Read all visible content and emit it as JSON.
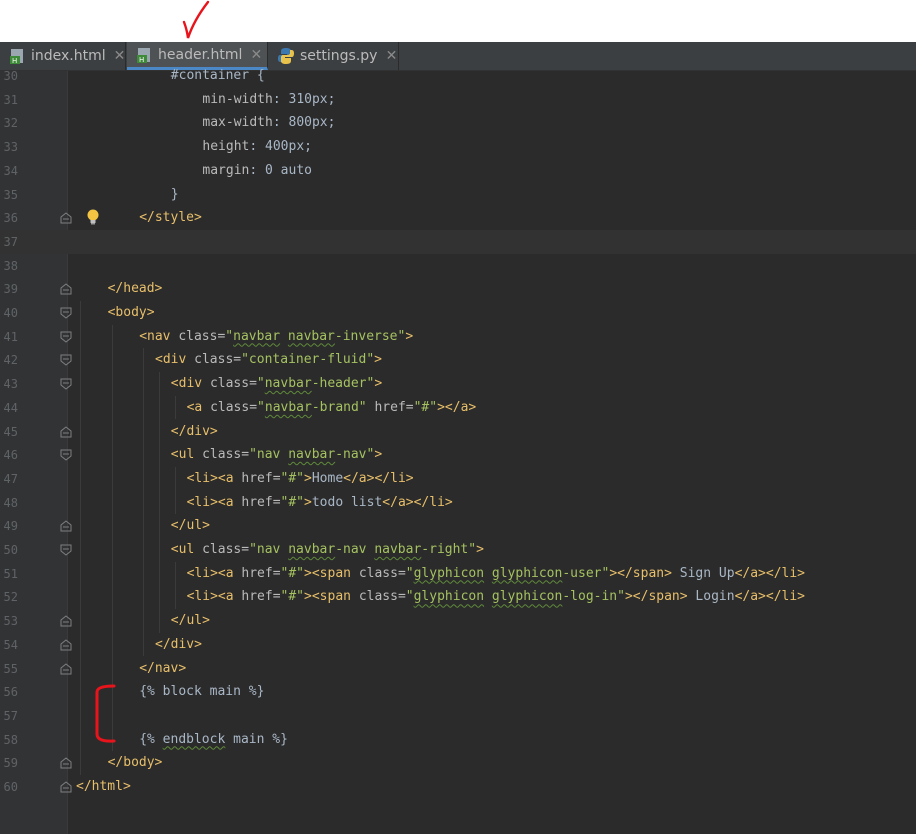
{
  "tabs": [
    {
      "name": "index.html",
      "active": false,
      "type": "html"
    },
    {
      "name": "header.html",
      "active": true,
      "type": "html"
    },
    {
      "name": "settings.py",
      "active": false,
      "type": "python"
    }
  ],
  "current_line": 37,
  "lines": [
    {
      "n": "30",
      "code": [
        {
          "t": "#container {",
          "c": "txt"
        }
      ]
    },
    {
      "n": "31",
      "code": [
        {
          "t": "min-width",
          "c": "prop"
        },
        {
          "t": ": ",
          "c": "txt"
        },
        {
          "t": "310px",
          "c": "txt"
        },
        {
          "t": ";",
          "c": "txt"
        }
      ]
    },
    {
      "n": "32",
      "code": [
        {
          "t": "max-width",
          "c": "prop"
        },
        {
          "t": ": ",
          "c": "txt"
        },
        {
          "t": "800px",
          "c": "txt"
        },
        {
          "t": ";",
          "c": "txt"
        }
      ]
    },
    {
      "n": "33",
      "code": [
        {
          "t": "height",
          "c": "prop"
        },
        {
          "t": ": ",
          "c": "txt"
        },
        {
          "t": "400px",
          "c": "txt"
        },
        {
          "t": ";",
          "c": "txt"
        }
      ]
    },
    {
      "n": "34",
      "code": [
        {
          "t": "margin",
          "c": "prop"
        },
        {
          "t": ": ",
          "c": "txt"
        },
        {
          "t": "0 auto",
          "c": "txt"
        }
      ]
    },
    {
      "n": "35",
      "code": [
        {
          "t": "}",
          "c": "txt"
        }
      ]
    },
    {
      "n": "36",
      "code": [
        {
          "t": "</style>",
          "c": "tag"
        }
      ]
    },
    {
      "n": "37",
      "code": []
    },
    {
      "n": "38",
      "code": []
    },
    {
      "n": "39",
      "code": [
        {
          "t": "</head>",
          "c": "tag"
        }
      ]
    },
    {
      "n": "40",
      "code": [
        {
          "t": "<body>",
          "c": "tag"
        }
      ]
    },
    {
      "n": "41",
      "code": [
        {
          "t": "<nav ",
          "c": "tag"
        },
        {
          "t": "class=",
          "c": "attr"
        },
        {
          "t": "\"",
          "c": "str"
        },
        {
          "t": "navbar",
          "c": "str",
          "sq": true
        },
        {
          "t": " ",
          "c": "str"
        },
        {
          "t": "navbar",
          "c": "str",
          "sq": true
        },
        {
          "t": "-inverse\"",
          "c": "str"
        },
        {
          "t": ">",
          "c": "tag"
        }
      ]
    },
    {
      "n": "42",
      "code": [
        {
          "t": "<div ",
          "c": "tag"
        },
        {
          "t": "class=",
          "c": "attr"
        },
        {
          "t": "\"container-fluid\"",
          "c": "str"
        },
        {
          "t": ">",
          "c": "tag"
        }
      ]
    },
    {
      "n": "43",
      "code": [
        {
          "t": "<div ",
          "c": "tag"
        },
        {
          "t": "class=",
          "c": "attr"
        },
        {
          "t": "\"",
          "c": "str"
        },
        {
          "t": "navbar",
          "c": "str",
          "sq": true
        },
        {
          "t": "-header\"",
          "c": "str"
        },
        {
          "t": ">",
          "c": "tag"
        }
      ]
    },
    {
      "n": "44",
      "code": [
        {
          "t": "<a ",
          "c": "tag"
        },
        {
          "t": "class=",
          "c": "attr"
        },
        {
          "t": "\"",
          "c": "str"
        },
        {
          "t": "navbar",
          "c": "str",
          "sq": true
        },
        {
          "t": "-brand\" ",
          "c": "str"
        },
        {
          "t": "href=",
          "c": "attr"
        },
        {
          "t": "\"#\"",
          "c": "str"
        },
        {
          "t": "></a>",
          "c": "tag"
        }
      ]
    },
    {
      "n": "45",
      "code": [
        {
          "t": "</div>",
          "c": "tag"
        }
      ]
    },
    {
      "n": "46",
      "code": [
        {
          "t": "<ul ",
          "c": "tag"
        },
        {
          "t": "class=",
          "c": "attr"
        },
        {
          "t": "\"nav ",
          "c": "str"
        },
        {
          "t": "navbar",
          "c": "str",
          "sq": true
        },
        {
          "t": "-nav\"",
          "c": "str"
        },
        {
          "t": ">",
          "c": "tag"
        }
      ]
    },
    {
      "n": "47",
      "code": [
        {
          "t": "<li><a ",
          "c": "tag"
        },
        {
          "t": "href=",
          "c": "attr"
        },
        {
          "t": "\"#\"",
          "c": "str"
        },
        {
          "t": ">",
          "c": "tag"
        },
        {
          "t": "Home",
          "c": "txt"
        },
        {
          "t": "</a></li>",
          "c": "tag"
        }
      ]
    },
    {
      "n": "48",
      "code": [
        {
          "t": "<li><a ",
          "c": "tag"
        },
        {
          "t": "href=",
          "c": "attr"
        },
        {
          "t": "\"#\"",
          "c": "str"
        },
        {
          "t": ">",
          "c": "tag"
        },
        {
          "t": "todo list",
          "c": "txt"
        },
        {
          "t": "</a></li>",
          "c": "tag"
        }
      ]
    },
    {
      "n": "49",
      "code": [
        {
          "t": "</ul>",
          "c": "tag"
        }
      ]
    },
    {
      "n": "50",
      "code": [
        {
          "t": "<ul ",
          "c": "tag"
        },
        {
          "t": "class=",
          "c": "attr"
        },
        {
          "t": "\"nav ",
          "c": "str"
        },
        {
          "t": "navbar",
          "c": "str",
          "sq": true
        },
        {
          "t": "-nav ",
          "c": "str"
        },
        {
          "t": "navbar",
          "c": "str",
          "sq": true
        },
        {
          "t": "-right\"",
          "c": "str"
        },
        {
          "t": ">",
          "c": "tag"
        }
      ]
    },
    {
      "n": "51",
      "code": [
        {
          "t": "<li><a ",
          "c": "tag"
        },
        {
          "t": "href=",
          "c": "attr"
        },
        {
          "t": "\"#\"",
          "c": "str"
        },
        {
          "t": "><span ",
          "c": "tag"
        },
        {
          "t": "class=",
          "c": "attr"
        },
        {
          "t": "\"",
          "c": "str"
        },
        {
          "t": "glyphicon",
          "c": "str",
          "sq": true
        },
        {
          "t": " ",
          "c": "str"
        },
        {
          "t": "glyphicon",
          "c": "str",
          "sq": true
        },
        {
          "t": "-user\"",
          "c": "str"
        },
        {
          "t": "></span>",
          "c": "tag"
        },
        {
          "t": " Sign Up",
          "c": "txt"
        },
        {
          "t": "</a></li>",
          "c": "tag"
        }
      ]
    },
    {
      "n": "52",
      "code": [
        {
          "t": "<li><a ",
          "c": "tag"
        },
        {
          "t": "href=",
          "c": "attr"
        },
        {
          "t": "\"#\"",
          "c": "str"
        },
        {
          "t": "><span ",
          "c": "tag"
        },
        {
          "t": "class=",
          "c": "attr"
        },
        {
          "t": "\"",
          "c": "str"
        },
        {
          "t": "glyphicon",
          "c": "str",
          "sq": true
        },
        {
          "t": " ",
          "c": "str"
        },
        {
          "t": "glyphicon",
          "c": "str",
          "sq": true
        },
        {
          "t": "-log-in\"",
          "c": "str"
        },
        {
          "t": "></span>",
          "c": "tag"
        },
        {
          "t": " Login",
          "c": "txt"
        },
        {
          "t": "</a></li>",
          "c": "tag"
        }
      ]
    },
    {
      "n": "53",
      "code": [
        {
          "t": "</ul>",
          "c": "tag"
        }
      ]
    },
    {
      "n": "54",
      "code": [
        {
          "t": "</div>",
          "c": "tag"
        }
      ]
    },
    {
      "n": "55",
      "code": [
        {
          "t": "</nav>",
          "c": "tag"
        }
      ]
    },
    {
      "n": "56",
      "code": [
        {
          "t": "{% block main %}",
          "c": "txt"
        }
      ]
    },
    {
      "n": "57",
      "code": []
    },
    {
      "n": "58",
      "code": [
        {
          "t": "{% ",
          "c": "txt"
        },
        {
          "t": "endblock",
          "c": "txt",
          "sq": true
        },
        {
          "t": " main %}",
          "c": "txt"
        }
      ]
    },
    {
      "n": "59",
      "code": [
        {
          "t": "</body>",
          "c": "tag"
        }
      ]
    },
    {
      "n": "60",
      "code": [
        {
          "t": "</html>",
          "c": "tag"
        }
      ]
    }
  ]
}
